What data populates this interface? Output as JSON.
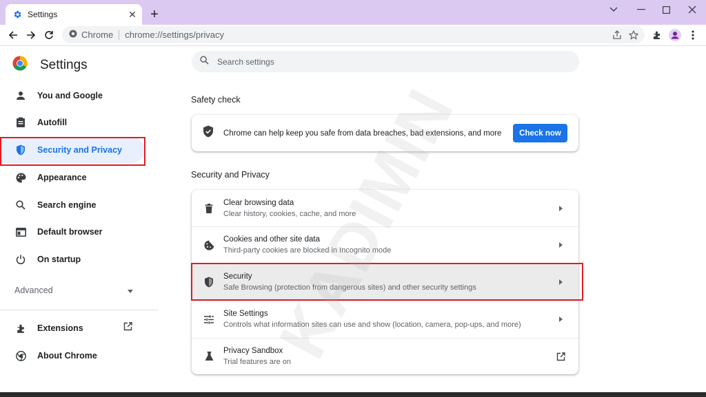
{
  "browser": {
    "tab_title": "Settings",
    "new_tab": "+",
    "site_label": "Chrome",
    "url": "chrome://settings/privacy"
  },
  "sidebar": {
    "title": "Settings",
    "items": [
      {
        "label": "You and Google"
      },
      {
        "label": "Autofill"
      },
      {
        "label": "Security and Privacy"
      },
      {
        "label": "Appearance"
      },
      {
        "label": "Search engine"
      },
      {
        "label": "Default browser"
      },
      {
        "label": "On startup"
      }
    ],
    "advanced": "Advanced",
    "bottom_items": [
      {
        "label": "Extensions"
      },
      {
        "label": "About Chrome"
      }
    ]
  },
  "main": {
    "search_placeholder": "Search settings",
    "safety_check": {
      "title": "Safety check",
      "text": "Chrome can help keep you safe from data breaches, bad extensions, and more",
      "button": "Check now"
    },
    "privacy": {
      "title": "Security and Privacy",
      "rows": [
        {
          "primary": "Clear browsing data",
          "secondary": "Clear history, cookies, cache, and more"
        },
        {
          "primary": "Cookies and other site data",
          "secondary": "Third-party cookies are blocked in Incognito mode"
        },
        {
          "primary": "Security",
          "secondary": "Safe Browsing (protection from dangerous sites) and other security settings"
        },
        {
          "primary": "Site Settings",
          "secondary": "Controls what information sites can use and show (location, camera, pop-ups, and more)"
        },
        {
          "primary": "Privacy Sandbox",
          "secondary": "Trial features are on"
        }
      ]
    }
  },
  "watermark": "KADIMIN",
  "colors": {
    "accent": "#1a73e8",
    "highlight": "#e11b22",
    "titlebar": "#dcc9f2",
    "active_bg": "#e8f0fe"
  }
}
